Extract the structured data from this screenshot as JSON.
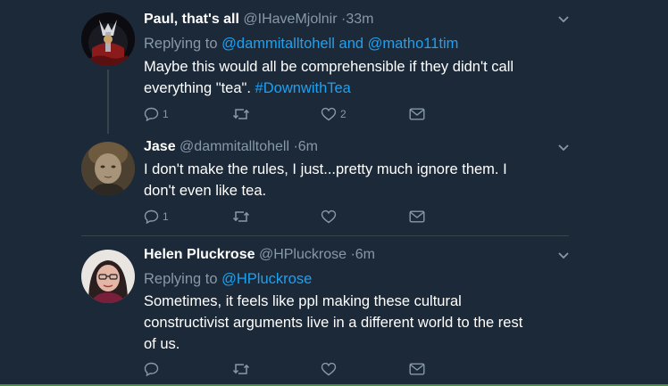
{
  "tweets": [
    {
      "name": "Paul, that's all",
      "handle": "@IHaveMjolnir",
      "dot": "·",
      "time": "33m",
      "replying_prefix": "Replying to ",
      "replying_users": "@dammitalltohell and @matho11tim",
      "text_line1": "Maybe this would all be comprehensible if they didn't call",
      "text_line2_plain": "everything \"tea\". ",
      "text_line2_tag": "#DownwithTea",
      "reply_count": "1",
      "retweet_count": "",
      "like_count": "2"
    },
    {
      "name": "Jase",
      "handle": "@dammitalltohell",
      "dot": "·",
      "time": "6m",
      "text_line1": "I don't make the rules, I just...pretty much ignore them. I",
      "text_line2": "don't even like tea.",
      "reply_count": "1",
      "retweet_count": "",
      "like_count": ""
    },
    {
      "name": "Helen Pluckrose",
      "handle": "@HPluckrose",
      "dot": "·",
      "time": "6m",
      "replying_prefix": "Replying to ",
      "replying_users": "@HPluckrose",
      "text_line1": "Sometimes, it feels like ppl making these cultural",
      "text_line2": "constructivist arguments live in a different world to the rest",
      "text_line3": "of us.",
      "reply_count": "",
      "retweet_count": "",
      "like_count": ""
    }
  ],
  "icons": {
    "reply": "reply-icon",
    "retweet": "retweet-icon",
    "like": "heart-icon",
    "dm": "envelope-icon",
    "more": "chevron-down-icon"
  },
  "colors": {
    "background": "#1c2938",
    "secondary_text": "#8899a6",
    "link": "#1da1f2",
    "divider": "#38444d"
  }
}
